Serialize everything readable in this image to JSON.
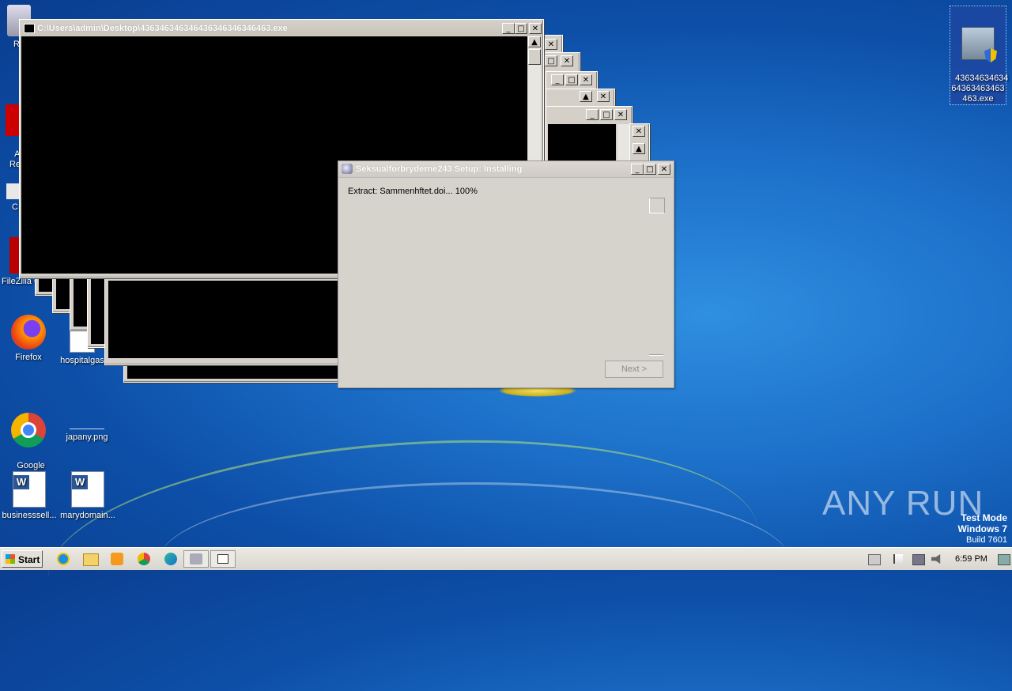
{
  "desktop": {
    "icons": [
      {
        "label": "Re"
      },
      {
        "label": "A\nRe"
      },
      {
        "label": "C"
      },
      {
        "label": "FileZilla C"
      },
      {
        "label": "Firefox"
      },
      {
        "label": "hospitalgas"
      },
      {
        "label": "Google\nChrome"
      },
      {
        "label": "japany.png"
      },
      {
        "label": "businesssell..."
      },
      {
        "label": "marydomain..."
      },
      {
        "label": "43634634634\n64363463463\n463.exe"
      }
    ],
    "watermark": {
      "brand": "ANY RUN",
      "mode_line1": "Test Mode",
      "mode_line2": "Windows 7",
      "mode_line3": "Build 7601"
    }
  },
  "console_window": {
    "title": "C:\\Users\\admin\\Desktop\\436346346346436346346346463.exe",
    "minimize": "_",
    "maximize": "□",
    "close": "✕"
  },
  "setup_dialog": {
    "title": "Seksualforbryderne243 Setup: Installing",
    "status": "Extract: Sammenhftet.doi... 100%",
    "next_button": "Next >",
    "minimize": "_",
    "maximize": "□",
    "close": "✕"
  },
  "taskbar": {
    "start_label": "Start",
    "clock": "6:59 PM"
  },
  "colors": {
    "desktop_blue": "#1c6fc8",
    "console_black": "#000000",
    "dialog_gray": "#d6d2cc"
  }
}
